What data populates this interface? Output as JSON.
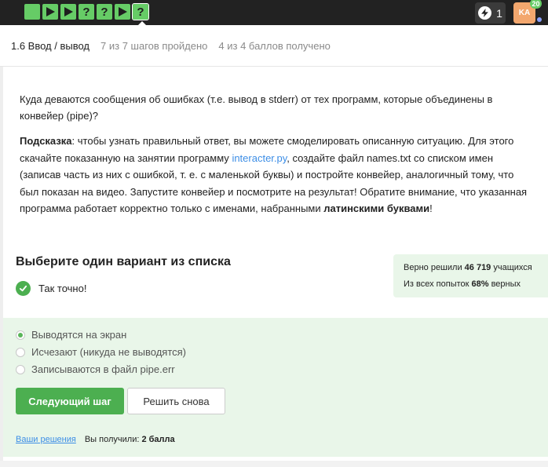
{
  "topbar": {
    "steps": [
      {
        "kind": "square",
        "icon": "square-icon"
      },
      {
        "kind": "play",
        "icon": "play-icon"
      },
      {
        "kind": "play",
        "icon": "play-icon"
      },
      {
        "kind": "quiz",
        "label": "?"
      },
      {
        "kind": "quiz",
        "label": "?"
      },
      {
        "kind": "play",
        "icon": "play-icon"
      },
      {
        "kind": "quiz",
        "label": "?",
        "current": true
      }
    ],
    "energy_count": "1",
    "avatar_initials": "KA",
    "avatar_badge": "20"
  },
  "lesson": {
    "title": "1.6 Ввод / вывод",
    "steps_done": "7 из 7 шагов пройдено",
    "points": "4 из 4 баллов  получено"
  },
  "question": {
    "text": "Куда деваются сообщения об ошибках (т.е. вывод в stderr) от тех программ, которые объединены в конвейер (pipe)?",
    "hint_label": "Подсказка",
    "hint_part1": ": чтобы узнать правильный ответ, вы можете смоделировать описанную ситуацию. Для этого скачайте показанную на занятии программу ",
    "hint_link": "interacter.py",
    "hint_part2": ", создайте файл names.txt со списком имен (записав часть из них с ошибкой, т. е. с маленькой буквы) и постройте конвейер, аналогичный тому, что был показан на видео. Запустите конвейер и посмотрите на результат! Обратите внимание, что указанная программа работает корректно только с именами, набранными ",
    "hint_bold": "латинскими буквами",
    "hint_end": "!"
  },
  "quiz": {
    "choose_title": "Выберите один вариант из списка",
    "feedback": "Так точно!",
    "options": [
      {
        "label": "Выводятся на экран",
        "checked": true
      },
      {
        "label": "Исчезают (никуда не выводятся)",
        "checked": false
      },
      {
        "label": "Записываются в файл pipe.err",
        "checked": false
      }
    ],
    "next_button": "Следующий шаг",
    "retry_button": "Решить снова",
    "solutions_link": "Ваши решения",
    "got_label": "Вы получили: ",
    "got_value": "2 балла"
  },
  "stats": {
    "solved_prefix": "Верно решили ",
    "solved_count": "46 719",
    "solved_suffix": " учащихся",
    "attempts_prefix": "Из всех попыток ",
    "attempts_percent": "68%",
    "attempts_suffix": " верных"
  },
  "colors": {
    "accent_green": "#66cc66",
    "button_green": "#4caf50",
    "panel_green": "#e9f6e9",
    "link_blue": "#3d8ee6",
    "topbar_dark": "#222222"
  }
}
